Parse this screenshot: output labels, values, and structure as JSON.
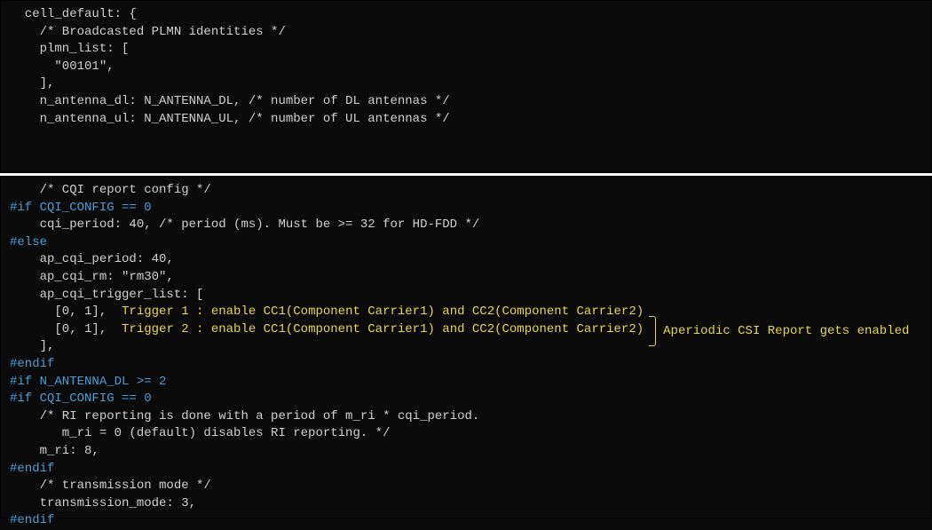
{
  "top": {
    "l1": "  cell_default: {",
    "l2": "",
    "l3": "    /* Broadcasted PLMN identities */",
    "l4": "    plmn_list: [",
    "l5": "      \"00101\",",
    "l6": "    ],",
    "l7": "",
    "l8": "    n_antenna_dl: N_ANTENNA_DL, /* number of DL antennas */",
    "l9": "    n_antenna_ul: N_ANTENNA_UL, /* number of UL antennas */"
  },
  "bot": {
    "l1": "    /* CQI report config */",
    "l2": "#if CQI_CONFIG == 0",
    "l3": "    cqi_period: 40, /* period (ms). Must be >= 32 for HD-FDD */",
    "l4": "#else",
    "l5": "    ap_cqi_period: 40,",
    "l6": "    ap_cqi_rm: \"rm30\",",
    "l7": "    ap_cqi_trigger_list: [",
    "l8a": "      [0, 1],  ",
    "l8b": "Trigger 1 : enable CC1(Component Carrier1) and CC2(Component Carrier2)",
    "l9a": "      [0, 1],  ",
    "l9b": "Trigger 2 : enable CC1(Component Carrier1) and CC2(Component Carrier2)",
    "sideLabel": "Aperiodic CSI Report gets enabled",
    "l10": "    ],",
    "l11": "#endif",
    "l12": "",
    "l13": "#if N_ANTENNA_DL >= 2",
    "l14": "#if CQI_CONFIG == 0",
    "l15": "    /* RI reporting is done with a period of m_ri * cqi_period.",
    "l16": "       m_ri = 0 (default) disables RI reporting. */",
    "l17": "    m_ri: 8,",
    "l18": "#endif",
    "l19": "    /* transmission mode */",
    "l20": "    transmission_mode: 3,",
    "l21": "#endif"
  }
}
